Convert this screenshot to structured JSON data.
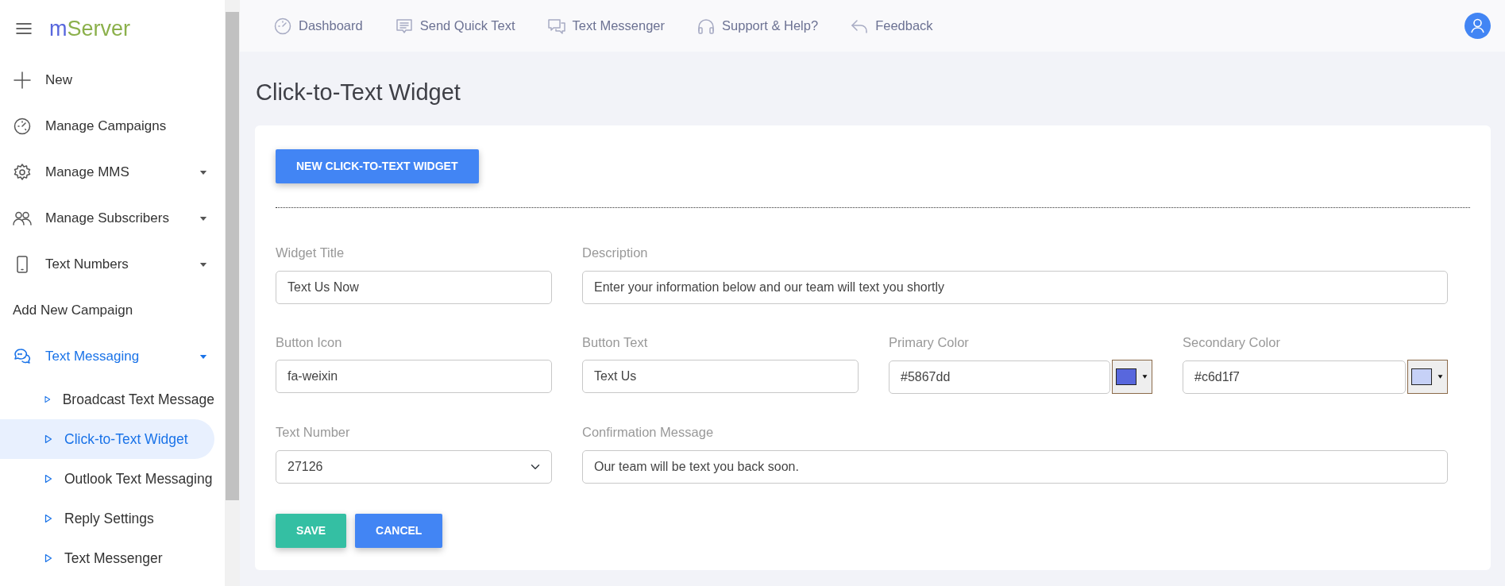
{
  "brand": {
    "first": "m",
    "rest": "Server"
  },
  "sidebar": {
    "items": [
      {
        "label": "New",
        "selected": false,
        "has_caret": false
      },
      {
        "label": "Manage Campaigns",
        "selected": false,
        "has_caret": false
      },
      {
        "label": "Manage MMS",
        "selected": false,
        "has_caret": true
      },
      {
        "label": "Manage Subscribers",
        "selected": false,
        "has_caret": true
      },
      {
        "label": "Text Numbers",
        "selected": false,
        "has_caret": true
      },
      {
        "label": "Add New Campaign",
        "selected": false,
        "has_caret": false
      },
      {
        "label": "Text Messaging",
        "selected": true,
        "has_caret": true,
        "children": [
          {
            "label": "Broadcast Text Message",
            "selected": false
          },
          {
            "label": "Click-to-Text Widget",
            "selected": true
          },
          {
            "label": "Outlook Text Messaging",
            "selected": false
          },
          {
            "label": "Reply Settings",
            "selected": false
          },
          {
            "label": "Text Messenger",
            "selected": false
          }
        ]
      }
    ]
  },
  "top_nav": [
    {
      "label": "Dashboard"
    },
    {
      "label": "Send Quick Text"
    },
    {
      "label": "Text Messenger"
    },
    {
      "label": "Support & Help?"
    },
    {
      "label": "Feedback"
    }
  ],
  "page_title": "Click-to-Text Widget",
  "new_button": "NEW CLICK-TO-TEXT WIDGET",
  "fields": [
    {
      "kind": "text",
      "label": "Widget Title",
      "value": "Text Us Now"
    },
    {
      "kind": "wide",
      "label": "Description",
      "value": "Enter your information below and our team will text you shortly"
    },
    {
      "kind": "text",
      "label": "Button Icon",
      "value": "fa-weixin"
    },
    {
      "kind": "text",
      "label": "Button Text",
      "value": "Text Us"
    },
    {
      "kind": "color",
      "label": "Primary Color",
      "value": "#5867dd",
      "color": "#5867dd"
    },
    {
      "kind": "color",
      "label": "Secondary Color",
      "value": "#c6d1f7",
      "color": "#c6d1f7"
    },
    {
      "kind": "select",
      "label": "Text Number",
      "value": "27126"
    },
    {
      "kind": "wide",
      "label": "Confirmation Message",
      "value": "Our team will be text you back soon."
    }
  ],
  "actions": [
    {
      "kind": "success",
      "label": "SAVE"
    },
    {
      "kind": "primary",
      "label": "CANCEL"
    }
  ]
}
